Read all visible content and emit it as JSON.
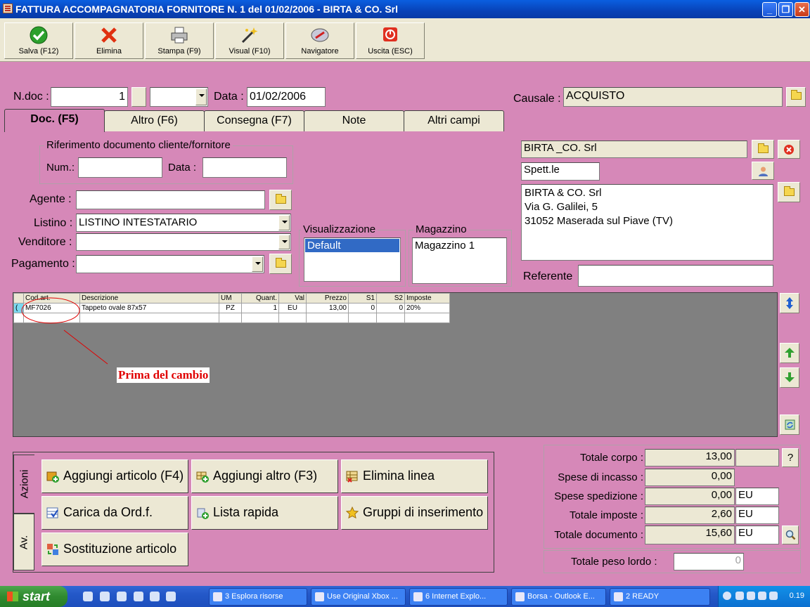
{
  "window": {
    "title": "FATTURA ACCOMPAGNATORIA FORNITORE N. 1  del 01/02/2006 - BIRTA & CO. Srl"
  },
  "toolbar": {
    "buttons": [
      {
        "label": "Salva (F12)",
        "icon": "check-icon"
      },
      {
        "label": "Elimina",
        "icon": "delete-x-icon"
      },
      {
        "label": "Stampa (F9)",
        "icon": "printer-icon"
      },
      {
        "label": "Visual (F10)",
        "icon": "magic-wand-icon"
      },
      {
        "label": "Navigatore",
        "icon": "compass-icon"
      },
      {
        "label": "Uscita (ESC)",
        "icon": "power-icon"
      }
    ]
  },
  "header": {
    "ndoc_label": "N.doc :",
    "ndoc_value": "1",
    "series_value": "",
    "data_label": "Data :",
    "data_value": "01/02/2006",
    "causale_label": "Causale :",
    "causale_value": "ACQUISTO"
  },
  "tabs": [
    {
      "label": "Doc. (F5)",
      "active": true
    },
    {
      "label": "Altro (F6)"
    },
    {
      "label": "Consegna (F7)"
    },
    {
      "label": "Note"
    },
    {
      "label": "Altri campi"
    }
  ],
  "riferimento": {
    "legend": "Riferimento documento cliente/fornitore",
    "num_label": "Num.:",
    "num_value": "",
    "data_label": "Data :",
    "data_value": ""
  },
  "form": {
    "agente_label": "Agente :",
    "agente_value": "",
    "listino_label": "Listino :",
    "listino_value": "LISTINO INTESTATARIO",
    "venditore_label": "Venditore :",
    "venditore_value": "",
    "pagamento_label": "Pagamento :",
    "pagamento_value": ""
  },
  "visualizzazione": {
    "legend": "Visualizzazione",
    "items": [
      "Default"
    ]
  },
  "magazzino": {
    "legend": "Magazzino",
    "items": [
      "Magazzino 1"
    ]
  },
  "cliente": {
    "ragione_sociale": "BIRTA _CO. Srl",
    "titolo": "Spett.le",
    "indirizzo": [
      "BIRTA & CO. Srl",
      "Via G. Galilei, 5",
      "31052 Maserada sul Piave (TV)"
    ],
    "referente_label": "Referente",
    "referente_value": ""
  },
  "grid": {
    "columns": [
      "Cod.art.",
      "Descrizione",
      "UM",
      "Quant.",
      "Val",
      "Prezzo",
      "S1",
      "S2",
      "Imposte"
    ],
    "rows": [
      [
        "MF7026",
        "Tappeto ovale 87x57",
        "PZ",
        "1",
        "EU",
        "13,00",
        "0",
        "0",
        "20%"
      ]
    ]
  },
  "annotation": {
    "text": "Prima del cambio",
    "color": "#e00000"
  },
  "actions": {
    "vtab_azioni": "Azioni",
    "vtab_av": "Av.",
    "buttons": [
      {
        "label": "Aggiungi articolo (F4)"
      },
      {
        "label": "Aggiungi altro (F3)"
      },
      {
        "label": "Elimina linea"
      },
      {
        "label": "Carica da Ord.f."
      },
      {
        "label": "Lista rapida"
      },
      {
        "label": "Gruppi di inserimento"
      },
      {
        "label": "Sostituzione articolo"
      }
    ]
  },
  "totals": {
    "totale_corpo_label": "Totale corpo :",
    "totale_corpo_value": "13,00",
    "help_label": "?",
    "spese_incasso_label": "Spese di incasso :",
    "spese_incasso_value": "0,00",
    "spese_spedizione_label": "Spese spedizione :",
    "spese_spedizione_value": "0,00",
    "spese_spedizione_cur": "EU",
    "totale_imposte_label": "Totale imposte :",
    "totale_imposte_value": "2,60",
    "totale_imposte_cur": "EU",
    "totale_documento_label": "Totale documento :",
    "totale_documento_value": "15,60",
    "totale_documento_cur": "EU",
    "peso_label": "Totale peso lordo :",
    "peso_value": "0"
  },
  "taskbar": {
    "start_label": "start",
    "tasks": [
      {
        "label": "3 Esplora risorse"
      },
      {
        "label": "Use Original Xbox ..."
      },
      {
        "label": "6 Internet Explo..."
      },
      {
        "label": "Borsa - Outlook E..."
      },
      {
        "label": "2 READY"
      }
    ],
    "clock": "0.19"
  }
}
